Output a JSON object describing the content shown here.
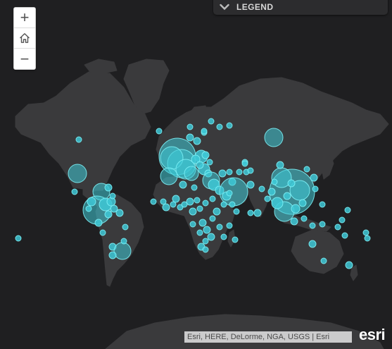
{
  "map": {
    "colors": {
      "background": "#1f1f21",
      "land": "#3a3a3c",
      "marker_fill": "#3ec8d6",
      "marker_stroke": "#7cf0f5"
    }
  },
  "zoom_controls": {
    "zoom_in_label": "+",
    "home_icon": "home-icon",
    "zoom_out_label": "−"
  },
  "legend": {
    "title": "LEGEND",
    "toggle_icon": "chevron-down-icon"
  },
  "attribution": {
    "text": "Esri, HERE, DeLorme, NGA, USGS | Esri"
  },
  "logo": {
    "text": "esri"
  }
}
